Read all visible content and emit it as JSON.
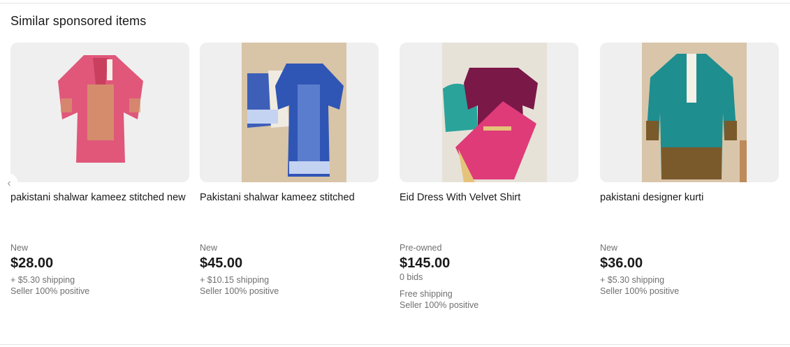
{
  "section": {
    "title": "Similar sponsored items"
  },
  "items": [
    {
      "title": "pakistani shalwar kameez stitched new",
      "condition": "New",
      "price": "$28.00",
      "shipping": "+ $5.30 shipping",
      "seller": "Seller 100% positive"
    },
    {
      "title": "Pakistani shalwar kameez stitched",
      "condition": "New",
      "price": "$45.00",
      "shipping": "+ $10.15 shipping",
      "seller": "Seller 100% positive"
    },
    {
      "title": "Eid Dress With Velvet Shirt",
      "condition": "Pre-owned",
      "price": "$145.00",
      "bids": "0 bids",
      "shipping": "Free shipping",
      "seller": "Seller 100% positive"
    },
    {
      "title": "pakistani designer kurti",
      "condition": "New",
      "price": "$36.00",
      "shipping": "+ $5.30 shipping",
      "seller": "Seller 100% positive"
    }
  ],
  "icons": {
    "prev": "chevron-left-icon"
  }
}
